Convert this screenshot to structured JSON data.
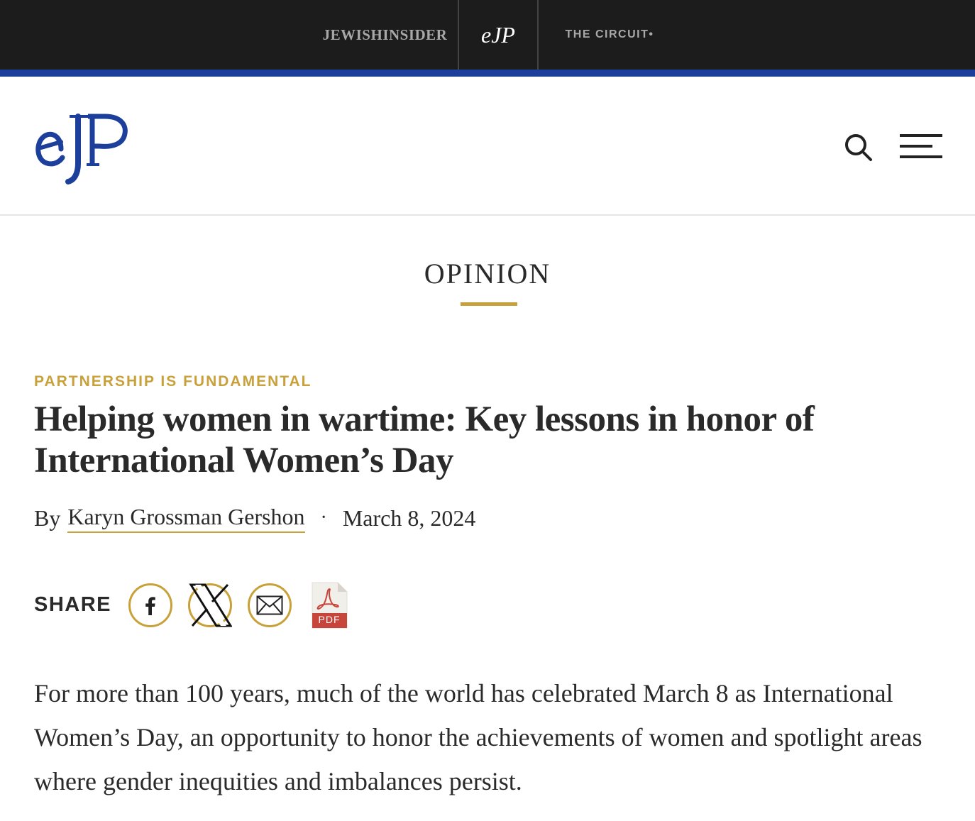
{
  "network_bar": {
    "items": [
      {
        "label": "JEWISHINSIDER"
      },
      {
        "label": "eJP"
      },
      {
        "label": "THE CIRCUIT•"
      }
    ]
  },
  "header": {
    "logo_text": "eJP",
    "search_icon": "search-icon",
    "menu_icon": "hamburger-menu-icon"
  },
  "section": {
    "label": "OPINION"
  },
  "article": {
    "kicker": "PARTNERSHIP IS FUNDAMENTAL",
    "headline": "Helping women in wartime: Key lessons in honor of International Women’s Day",
    "byline_prefix": "By",
    "author": "Karyn Grossman Gershon",
    "separator": "·",
    "date": "March 8, 2024",
    "body": "For more than 100 years, much of the world has celebrated March 8 as International Women’s Day, an opportunity to honor the achievements of women and spotlight areas where gender inequities and imbalances persist."
  },
  "share": {
    "label": "SHARE",
    "icons": [
      "facebook-icon",
      "x-icon",
      "email-icon",
      "pdf-icon"
    ],
    "pdf_label": "PDF"
  },
  "colors": {
    "accent_gold": "#c9a13b",
    "brand_blue": "#1b3f9a",
    "dark_bar": "#1c1c1c",
    "text": "#2a2a2a"
  }
}
